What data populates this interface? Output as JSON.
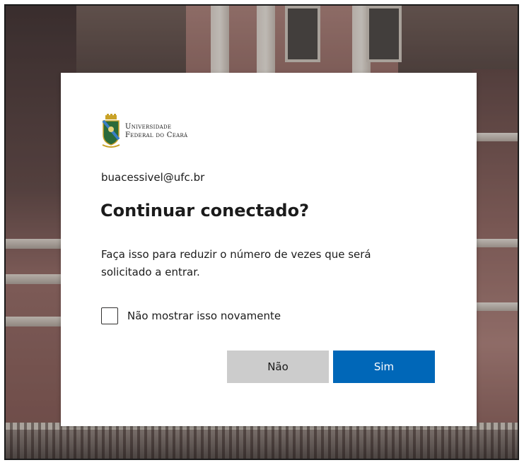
{
  "logo": {
    "line1": "Universidade",
    "line2": "Federal do Ceará"
  },
  "account": {
    "email": "buacessivel@ufc.br"
  },
  "dialog": {
    "title": "Continuar conectado?",
    "description": "Faça isso para reduzir o número de vezes que será solicitado a entrar.",
    "checkbox_label": "Não mostrar isso novamente",
    "checkbox_checked": false,
    "no_label": "Não",
    "yes_label": "Sim"
  },
  "colors": {
    "primary_button": "#0067b8",
    "secondary_button": "#cccccc"
  }
}
